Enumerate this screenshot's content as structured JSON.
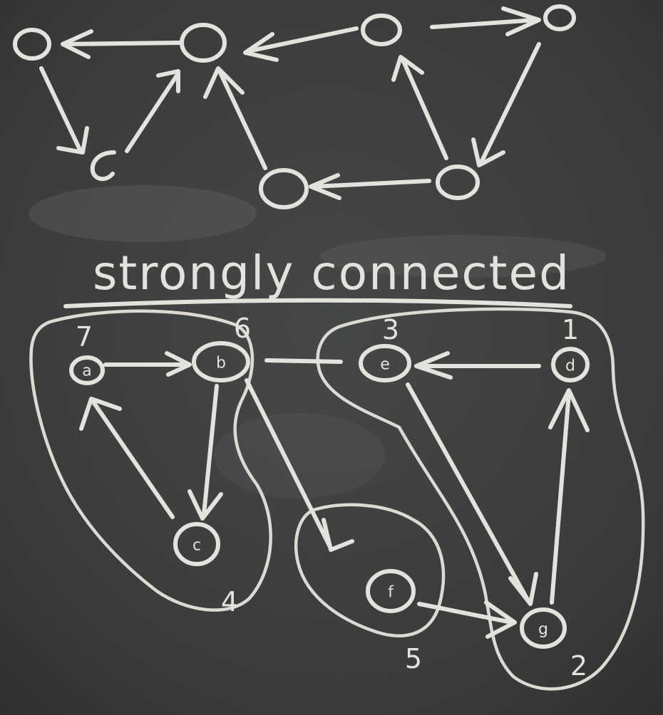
{
  "board": {
    "heading": "strongly connected",
    "colors": {
      "board": "#3b3d3c",
      "chalk": "#e4e2dc"
    }
  },
  "nodes": [
    {
      "letter": "a",
      "number": "7"
    },
    {
      "letter": "b",
      "number": "6"
    },
    {
      "letter": "c",
      "number": "4"
    },
    {
      "letter": "e",
      "number": "3"
    },
    {
      "letter": "d",
      "number": "1"
    },
    {
      "letter": "f",
      "number": "5"
    },
    {
      "letter": "g",
      "number": "2"
    }
  ]
}
